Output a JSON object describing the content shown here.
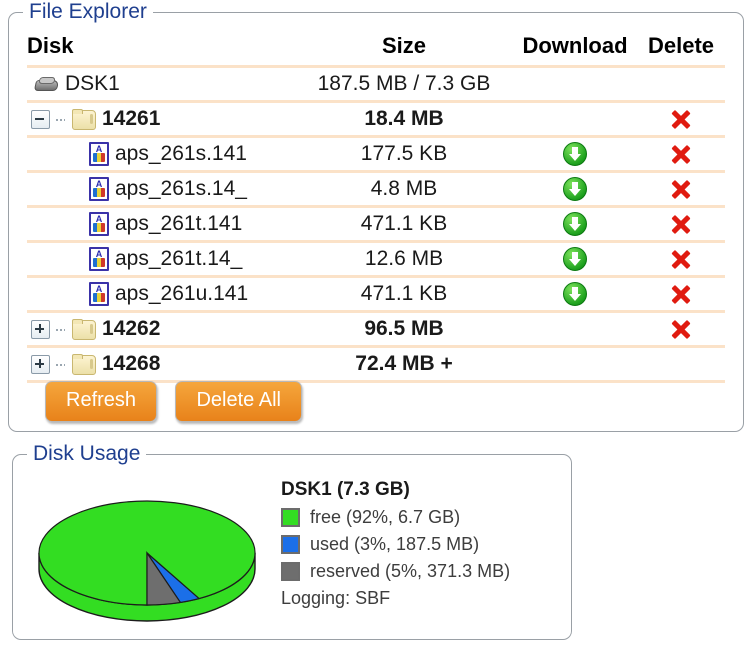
{
  "file_explorer": {
    "legend": "File Explorer",
    "columns": {
      "name": "Disk",
      "size": "Size",
      "download": "Download",
      "delete": "Delete"
    },
    "rows": [
      {
        "kind": "disk",
        "icon": "disk-icon",
        "name": "DSK1",
        "size": "187.5 MB / 7.3 GB",
        "download": false,
        "delete": false,
        "bold": false,
        "indent": 0
      },
      {
        "kind": "folder",
        "icon": "folder-open-icon",
        "twisty": "minus",
        "name": "14261",
        "size": "18.4 MB",
        "download": false,
        "delete": true,
        "bold": true,
        "indent": 1
      },
      {
        "kind": "file",
        "icon": "file-icon",
        "name": "aps_261s.141",
        "size": "177.5 KB",
        "download": true,
        "delete": true,
        "bold": false,
        "indent": 2
      },
      {
        "kind": "file",
        "icon": "file-icon",
        "name": "aps_261s.14_",
        "size": "4.8 MB",
        "download": true,
        "delete": true,
        "bold": false,
        "indent": 2
      },
      {
        "kind": "file",
        "icon": "file-icon",
        "name": "aps_261t.141",
        "size": "471.1 KB",
        "download": true,
        "delete": true,
        "bold": false,
        "indent": 2
      },
      {
        "kind": "file",
        "icon": "file-icon",
        "name": "aps_261t.14_",
        "size": "12.6 MB",
        "download": true,
        "delete": true,
        "bold": false,
        "indent": 2
      },
      {
        "kind": "file",
        "icon": "file-icon",
        "name": "aps_261u.141",
        "size": "471.1 KB",
        "download": true,
        "delete": true,
        "bold": false,
        "indent": 2
      },
      {
        "kind": "folder",
        "icon": "folder-icon",
        "twisty": "plus",
        "name": "14262",
        "size": "96.5 MB",
        "download": false,
        "delete": true,
        "bold": true,
        "indent": 1
      },
      {
        "kind": "folder",
        "icon": "folder-icon",
        "twisty": "plus",
        "name": "14268",
        "size": "72.4 MB +",
        "download": false,
        "delete": false,
        "bold": true,
        "indent": 1
      }
    ],
    "buttons": {
      "refresh": "Refresh",
      "delete_all": "Delete All"
    }
  },
  "disk_usage": {
    "legend": "Disk Usage",
    "logging": "Logging: SBF"
  },
  "chart_data": {
    "type": "pie",
    "title": "DSK1 (7.3 GB)",
    "labels": [
      "free (92%, 6.7 GB)",
      "used (3%, 187.5 MB)",
      "reserved (5%, 371.3 MB)"
    ],
    "categories": [
      "free",
      "used",
      "reserved"
    ],
    "values": [
      92,
      3,
      5
    ],
    "absolute": [
      "6.7 GB",
      "187.5 MB",
      "371.3 MB"
    ],
    "colors": [
      "#33dd22",
      "#1b6fe8",
      "#6e6e6e"
    ],
    "legend_position": "right",
    "three_d": true,
    "total": "7.3 GB"
  },
  "colors": {
    "legend_text": "#1f3f8f",
    "row_separator": "#fbe2c8",
    "button": "#ef8b1e",
    "delete": "#e01b10",
    "download": "#1fa21f"
  }
}
